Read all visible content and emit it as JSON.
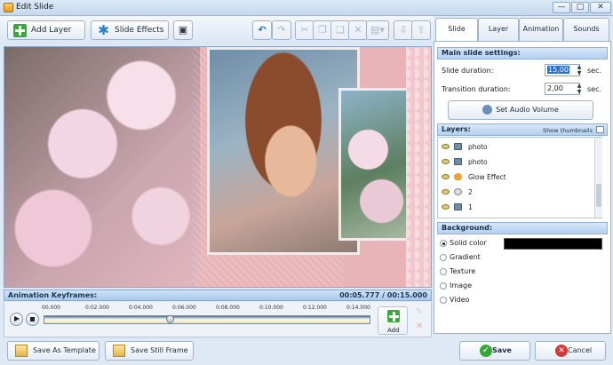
{
  "window": {
    "title": "Edit Slide",
    "controls": [
      "—",
      "□",
      "✕"
    ]
  },
  "toolbar": {
    "add_layer": "Add Layer",
    "slide_effects": "Slide Effects",
    "undo_glyph": "↶",
    "redo_glyph": "↷",
    "icons": [
      "scissors-icon",
      "copy-icon",
      "paste-icon",
      "delete-icon",
      "align-icon",
      "move-down-icon",
      "move-up-icon"
    ]
  },
  "tabs": [
    "Slide",
    "Layer",
    "Animation",
    "Sounds"
  ],
  "slide": {
    "section_title": "Main slide settings:",
    "duration_label": "Slide duration:",
    "duration_value": "15,00",
    "transition_label": "Transition duration:",
    "transition_value": "2,00",
    "unit": "sec.",
    "audio_button": "Set Audio Volume"
  },
  "layers": {
    "section_title": "Layers:",
    "show_thumbnails": "Show thumbnails",
    "items": [
      {
        "name": "photo",
        "icon": "photo-icon"
      },
      {
        "name": "photo",
        "icon": "photo-icon"
      },
      {
        "name": "Glow Effect",
        "icon": "glow-icon"
      },
      {
        "name": "2",
        "icon": "circle-icon"
      },
      {
        "name": "1",
        "icon": "photo-icon"
      }
    ]
  },
  "background": {
    "section_title": "Background:",
    "options": [
      "Solid color",
      "Gradient",
      "Texture",
      "Image",
      "Video"
    ],
    "selected": "Solid color",
    "color": "#000000"
  },
  "keyframes": {
    "title": "Animation Keyframes:",
    "time": "00:05.777 / 00:15.000",
    "ticks": [
      "00.000",
      "0:02.000",
      "0:04.000",
      "0:06.000",
      "0:08.000",
      "0:10.000",
      "0:12.000",
      "0:14.000"
    ],
    "playhead_fraction": 0.385,
    "add_label": "Add"
  },
  "bottom": {
    "save_template": "Save As Template",
    "save_frame": "Save Still Frame",
    "save": "Save",
    "cancel": "Cancel"
  }
}
